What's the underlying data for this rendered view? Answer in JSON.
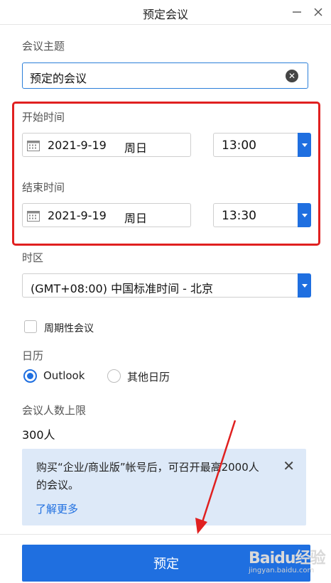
{
  "window": {
    "title": "预定会议",
    "minimize_icon": "minimize-icon",
    "close_icon": "close-icon"
  },
  "subject": {
    "label": "会议主题",
    "value": "预定的会议",
    "clear_icon": "clear-circle-icon"
  },
  "start": {
    "label": "开始时间",
    "date": "2021-9-19",
    "weekday": "周日",
    "time": "13:00"
  },
  "end": {
    "label": "结束时间",
    "date": "2021-9-19",
    "weekday": "周日",
    "time": "13:30"
  },
  "timezone": {
    "label": "时区",
    "value": "(GMT+08:00) 中国标准时间 - 北京"
  },
  "recurring": {
    "label": "周期性会议",
    "checked": false
  },
  "calendar": {
    "label": "日历",
    "options": [
      {
        "label": "Outlook",
        "selected": true
      },
      {
        "label": "其他日历",
        "selected": false
      }
    ]
  },
  "limit": {
    "label": "会议人数上限",
    "value": "300人"
  },
  "upgrade_notice": {
    "text": "购买“企业/商业版”帐号后，可召开最高2000人的会议。",
    "link": "了解更多"
  },
  "submit": {
    "label": "预定"
  },
  "watermark": {
    "brand": "Baidu经验",
    "url": "jingyan.baidu.com"
  },
  "colors": {
    "accent": "#1f6fe0",
    "highlight": "#e02020",
    "notice_bg": "#dde9f8"
  }
}
